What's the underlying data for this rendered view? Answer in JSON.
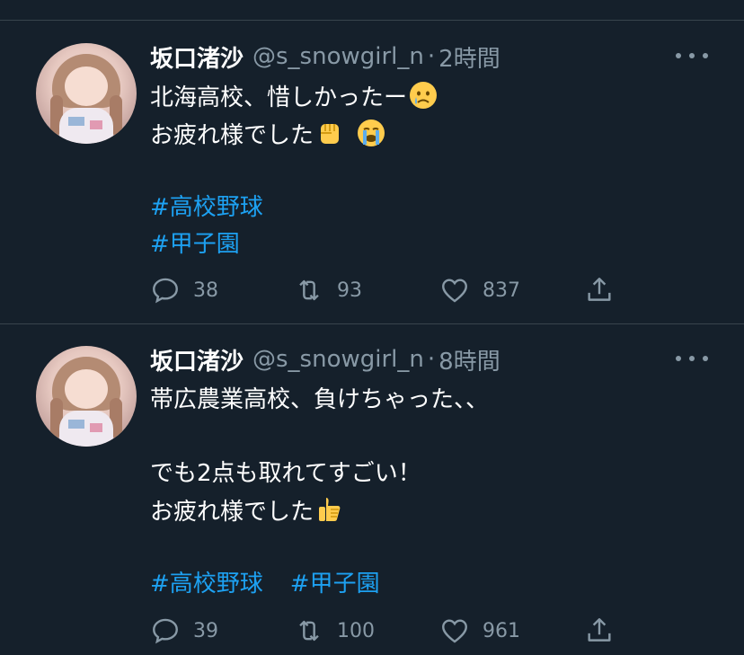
{
  "colors": {
    "background": "#15202b",
    "text": "#ffffff",
    "secondary": "#8899a6",
    "link": "#1da1f2",
    "divider": "#38444d"
  },
  "tweets": [
    {
      "name": "坂口渚沙",
      "handle": "@s_snowgirl_n",
      "separator": "·",
      "time": "2時間",
      "lines": [
        "北海高校、惜しかったー",
        "お疲れ様でした"
      ],
      "emojis": [
        "crying-face-emoji",
        "raised-fist-emoji",
        "loudly-crying-face-emoji"
      ],
      "hashtags": [
        "#高校野球",
        "#甲子園"
      ],
      "replies": "38",
      "retweets": "93",
      "likes": "837"
    },
    {
      "name": "坂口渚沙",
      "handle": "@s_snowgirl_n",
      "separator": "·",
      "time": "8時間",
      "lines": [
        "帯広農業高校、負けちゃった、、",
        "でも2点も取れてすごい！",
        "お疲れ様でした"
      ],
      "emojis": [
        "thumbs-up-emoji"
      ],
      "hashtags": [
        "#高校野球",
        "#甲子園"
      ],
      "replies": "39",
      "retweets": "100",
      "likes": "961"
    }
  ]
}
